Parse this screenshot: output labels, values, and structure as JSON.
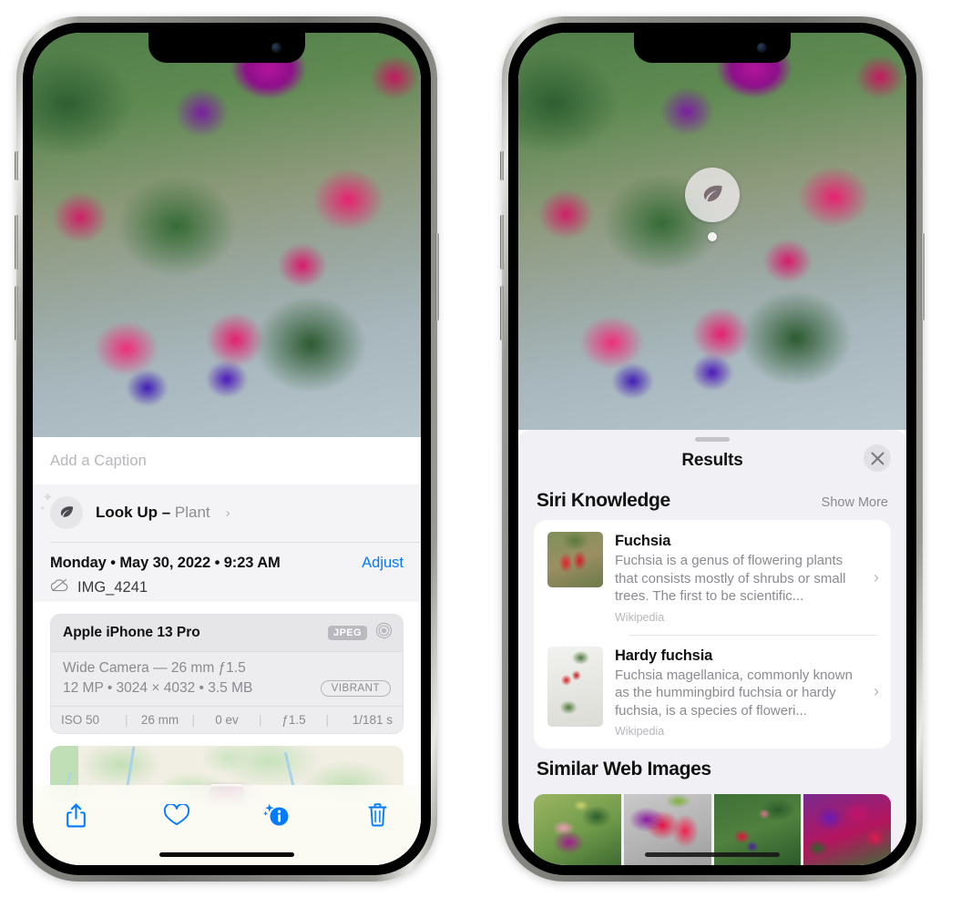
{
  "left_phone": {
    "photo": {
      "alt": "fuchsia-flowers-photo"
    },
    "caption": {
      "placeholder": "Add a Caption",
      "value": ""
    },
    "lookup": {
      "icon": "leaf-icon",
      "label": "Look Up",
      "dash": " – ",
      "subject": "Plant",
      "chevron": "›"
    },
    "metadata": {
      "date": "Monday • May 30, 2022 • 9:23 AM",
      "adjust_label": "Adjust",
      "cloud_icon": "cloud-slash-icon",
      "filename": "IMG_4241"
    },
    "camera_card": {
      "model": "Apple iPhone 13 Pro",
      "format_badge": "JPEG",
      "aperture_icon": "aperture-icon",
      "lens": "Wide Camera — 26 mm ƒ1.5",
      "size_line": "12 MP • 3024 × 4032 • 3.5 MB",
      "style_badge": "VIBRANT",
      "exif": [
        "ISO 50",
        "26 mm",
        "0 ev",
        "ƒ1.5",
        "1/181 s"
      ]
    },
    "toolbar": [
      {
        "name": "share-button",
        "icon": "share-icon"
      },
      {
        "name": "favorite-button",
        "icon": "heart-icon"
      },
      {
        "name": "info-button",
        "icon": "info-sparkle-icon"
      },
      {
        "name": "delete-button",
        "icon": "trash-icon"
      }
    ]
  },
  "right_phone": {
    "badge": {
      "icon": "leaf-icon"
    },
    "sheet": {
      "title": "Results",
      "close_icon": "close-icon",
      "siri_knowledge": {
        "title": "Siri Knowledge",
        "show_more": "Show More",
        "items": [
          {
            "title": "Fuchsia",
            "description": "Fuchsia is a genus of flowering plants that consists mostly of shrubs or small trees. The first to be scientific...",
            "source": "Wikipedia",
            "chevron": "›"
          },
          {
            "title": "Hardy fuchsia",
            "description": "Fuchsia magellanica, commonly known as the hummingbird fuchsia or hardy fuchsia, is a species of floweri...",
            "source": "Wikipedia",
            "chevron": "›"
          }
        ]
      },
      "similar_web_images": {
        "title": "Similar Web Images",
        "thumbnails": [
          "fuchsia-web-image-1",
          "fuchsia-web-image-2",
          "fuchsia-web-image-3",
          "fuchsia-web-image-4"
        ]
      }
    }
  },
  "colors": {
    "accent_blue": "#007aff",
    "sheet_bg": "#f1f0f5",
    "card_bg": "#ffffff",
    "secondary_text": "#8a8a90"
  }
}
